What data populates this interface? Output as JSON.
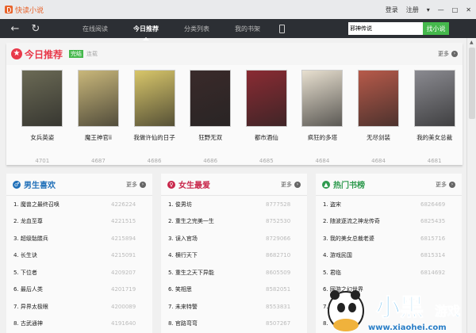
{
  "app": {
    "title": "快读小说",
    "login": "登录",
    "register": "注册"
  },
  "nav": {
    "tabs": [
      "在线阅读",
      "今日推荐",
      "分类列表",
      "我的书架"
    ],
    "search_value": "邪神传说",
    "search_button": "找小说"
  },
  "featured": {
    "title": "今日推荐",
    "tag_active": "完结",
    "tag_inactive": "连载",
    "more": "更多",
    "books": [
      {
        "name": "女兵英姿",
        "count": "4701",
        "color": "#6b6a55"
      },
      {
        "name": "魔王神官ii",
        "count": "4687",
        "color": "#c9b77a"
      },
      {
        "name": "我做许仙的日子",
        "count": "4686",
        "color": "#d8c66a"
      },
      {
        "name": "狂野无双",
        "count": "4686",
        "color": "#3a2a2a"
      },
      {
        "name": "都市酒仙",
        "count": "4685",
        "color": "#8a2b33"
      },
      {
        "name": "疯狂的多塔",
        "count": "4684",
        "color": "#e8e0d0"
      },
      {
        "name": "无尽剑装",
        "count": "4684",
        "color": "#b75a4a"
      },
      {
        "name": "我的美女总裁",
        "count": "4681",
        "color": "#8a8a90"
      }
    ]
  },
  "panels": [
    {
      "title": "男生喜欢",
      "color": "#1f6fb8",
      "icon": "♂",
      "more": "更多",
      "items": [
        {
          "name": "1. 魔兽之最终召唤",
          "value": "4226224"
        },
        {
          "name": "2. 龙血至尊",
          "value": "4221515"
        },
        {
          "name": "3. 超级骷髅兵",
          "value": "4215894"
        },
        {
          "name": "4. 长生诀",
          "value": "4215091"
        },
        {
          "name": "5. 下位者",
          "value": "4209207"
        },
        {
          "name": "6. 最后人类",
          "value": "4201719"
        },
        {
          "name": "7. 异界太极眼",
          "value": "4200089"
        },
        {
          "name": "8. 古武通神",
          "value": "4191640"
        }
      ]
    },
    {
      "title": "女生最爱",
      "color": "#c8264a",
      "icon": "♀",
      "more": "更多",
      "items": [
        {
          "name": "1. 俊男坊",
          "value": "8777528"
        },
        {
          "name": "2. 重生之完美一生",
          "value": "8752530"
        },
        {
          "name": "3. 误入官场",
          "value": "8729066"
        },
        {
          "name": "4. 横行天下",
          "value": "8682710"
        },
        {
          "name": "5. 重生之天下异能",
          "value": "8605509"
        },
        {
          "name": "6. 笑相思",
          "value": "8582051"
        },
        {
          "name": "7. 未来特警",
          "value": "8553831"
        },
        {
          "name": "8. 官路弯弯",
          "value": "8507267"
        }
      ]
    },
    {
      "title": "热门书榜",
      "color": "#2e9a4e",
      "icon": "▲",
      "more": "更多",
      "items": [
        {
          "name": "1. 盗宋",
          "value": "6826469"
        },
        {
          "name": "2. 随波逐流之神龙传奇",
          "value": "6825435"
        },
        {
          "name": "3. 我的美女总裁老婆",
          "value": "6815716"
        },
        {
          "name": "4. 游戏民国",
          "value": "6815314"
        },
        {
          "name": "5. 君临",
          "value": "6814692"
        },
        {
          "name": "6. 网游之幻世界",
          "value": ""
        },
        {
          "name": "7. 山里的科技",
          "value": ""
        },
        {
          "name": "8.",
          "value": ""
        }
      ]
    }
  ],
  "watermark": {
    "text": "小黑游戏",
    "url": "www.xiaohei.com"
  }
}
